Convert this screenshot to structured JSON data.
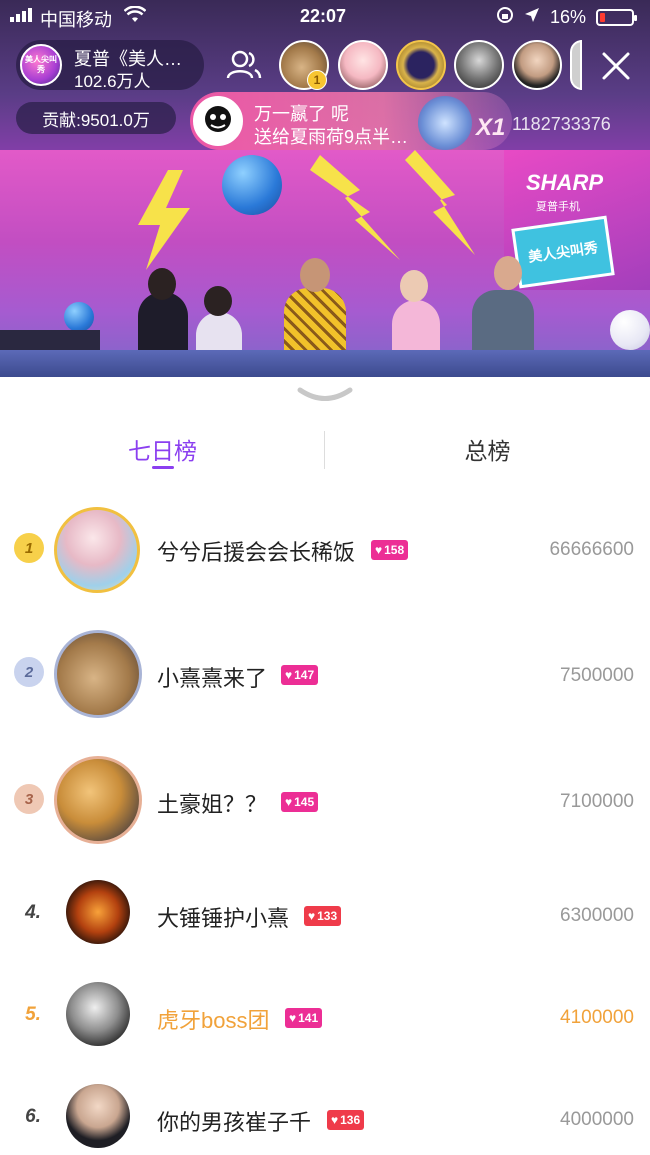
{
  "status_bar": {
    "carrier": "中国移动",
    "time": "22:07",
    "battery": "16%"
  },
  "anchor": {
    "name": "夏普《美人…",
    "viewers": "102.6万人",
    "avatar_text": "美人尖叫秀"
  },
  "viewer_badge": "1",
  "contribution": "贡献:9501.0万",
  "gift_banner": {
    "line1": "万一嬴了 呢",
    "line2": "送给夏雨荷9点半…",
    "multiplier": "X1"
  },
  "room_id": "1182733376",
  "stage": {
    "sharp_text": "SHARP",
    "sharp_sub": "夏普手机",
    "logo_text": "美人尖叫秀"
  },
  "tabs": [
    {
      "label": "七日榜",
      "active": true
    },
    {
      "label": "总榜",
      "active": false
    }
  ],
  "leaderboard": [
    {
      "rank": "1",
      "name": "兮兮后援会会长稀饭",
      "level": "158",
      "score": "66666600"
    },
    {
      "rank": "2",
      "name": "小熹熹来了",
      "level": "147",
      "score": "7500000"
    },
    {
      "rank": "3",
      "name": "土豪姐？？",
      "level": "145",
      "score": "7100000"
    },
    {
      "rank": "4.",
      "name": "大锤锤护小熹",
      "level": "133",
      "score": "6300000"
    },
    {
      "rank": "5.",
      "name": "虎牙boss团",
      "level": "141",
      "score": "4100000"
    },
    {
      "rank": "6.",
      "name": "你的男孩崔子千",
      "level": "136",
      "score": "4000000"
    }
  ],
  "colors": {
    "accent": "#8b3ff0",
    "gold": "#f1a23a",
    "level_pink": "#ec2e95",
    "level_red": "#ef3b4a"
  }
}
